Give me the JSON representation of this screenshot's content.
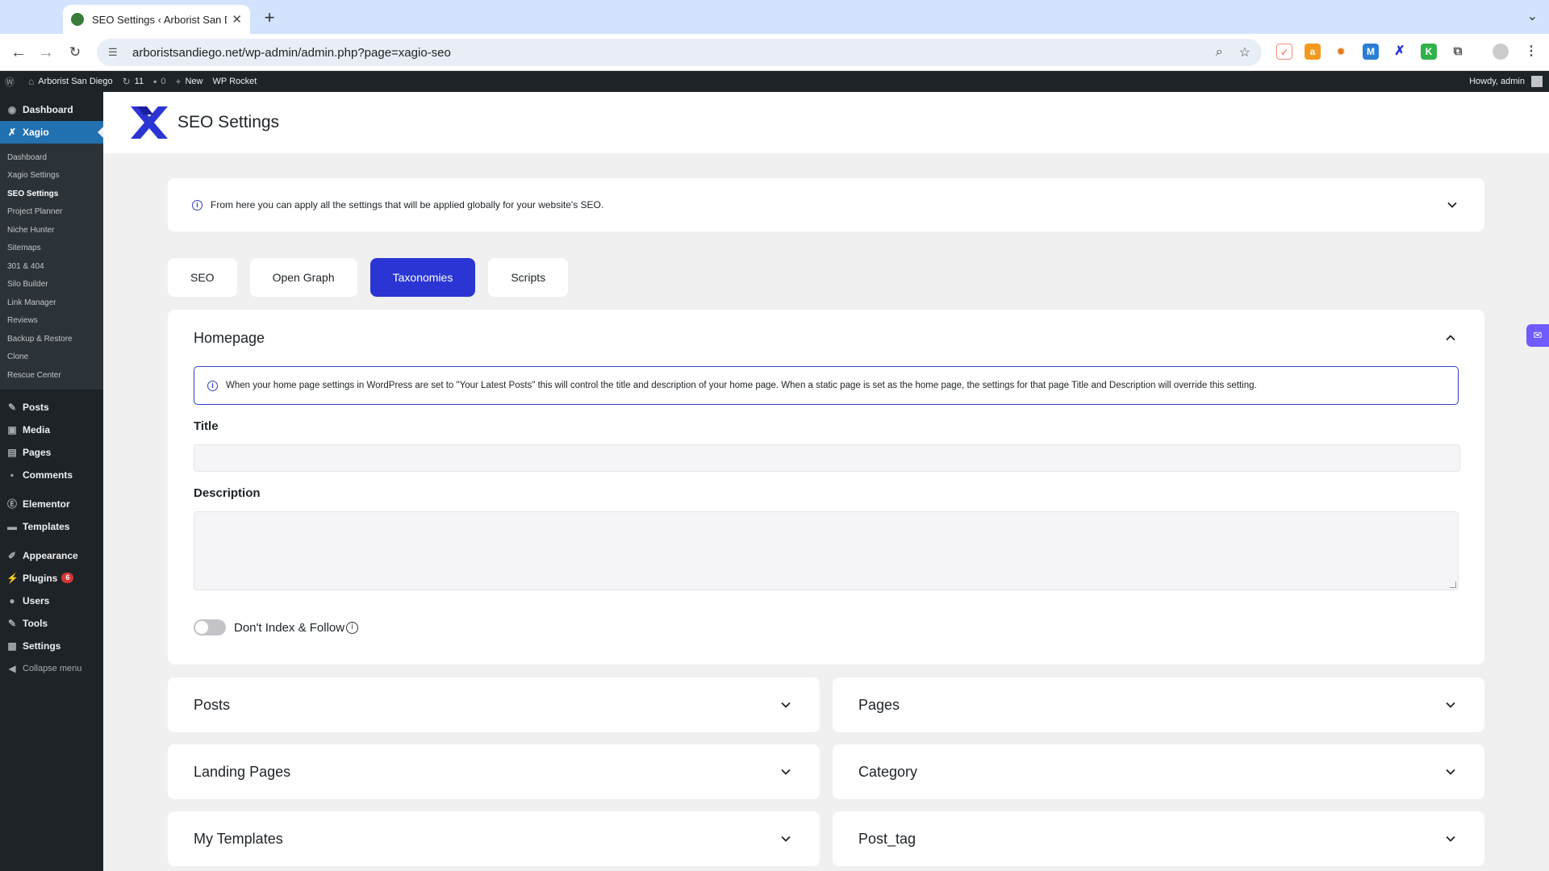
{
  "browser": {
    "tab_title": "SEO Settings ‹ Arborist San D",
    "url": "arboristsandiego.net/wp-admin/admin.php?page=xagio-seo"
  },
  "adminbar": {
    "site_name": "Arborist San Diego",
    "updates": "11",
    "comments": "0",
    "new_label": "New",
    "wp_rocket": "WP Rocket",
    "howdy": "Howdy, admin"
  },
  "sidebar": {
    "dashboard": "Dashboard",
    "xagio": "Xagio",
    "submenu": [
      "Dashboard",
      "Xagio Settings",
      "SEO Settings",
      "Project Planner",
      "Niche Hunter",
      "Sitemaps",
      "301 & 404",
      "Silo Builder",
      "Link Manager",
      "Reviews",
      "Backup & Restore",
      "Clone",
      "Rescue Center"
    ],
    "posts": "Posts",
    "media": "Media",
    "pages": "Pages",
    "comments": "Comments",
    "elementor": "Elementor",
    "templates": "Templates",
    "appearance": "Appearance",
    "plugins": "Plugins",
    "plugins_badge": "6",
    "users": "Users",
    "tools": "Tools",
    "settings": "Settings",
    "collapse": "Collapse menu"
  },
  "main": {
    "title": "SEO Settings",
    "info_text": "From here you can apply all the settings that will be applied globally for your website's SEO.",
    "tabs": [
      {
        "label": "SEO",
        "active": false
      },
      {
        "label": "Open Graph",
        "active": false
      },
      {
        "label": "Taxonomies",
        "active": true
      },
      {
        "label": "Scripts",
        "active": false
      }
    ],
    "homepage": {
      "title": "Homepage",
      "notice": "When your home page settings in WordPress are set to \"Your Latest Posts\" this will control the title and description of your home page. When a static page is set as the home page, the settings for that page Title and Description will override this setting.",
      "title_label": "Title",
      "title_value": "",
      "description_label": "Description",
      "description_value": "",
      "toggle_label": "Don't Index & Follow",
      "toggle_on": false
    },
    "accordions": {
      "posts": "Posts",
      "pages": "Pages",
      "landing_pages": "Landing Pages",
      "category": "Category",
      "my_templates": "My Templates",
      "post_tag": "Post_tag"
    }
  },
  "colors": {
    "accent": "#2a35d4",
    "wp_dark": "#1d2327",
    "wp_blue": "#2271b1"
  }
}
